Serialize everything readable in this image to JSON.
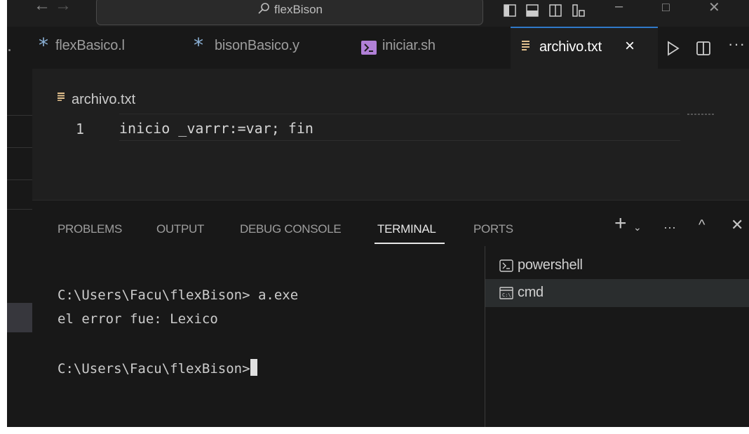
{
  "titlebar": {
    "command_center_text": "flexBison",
    "window_controls": [
      "minimize",
      "maximize",
      "close"
    ]
  },
  "tabs": [
    {
      "label": "flexBasico.l",
      "icon": "asterisk-icon",
      "active": false
    },
    {
      "label": "bisonBasico.y",
      "icon": "asterisk-icon",
      "active": false
    },
    {
      "label": "iniciar.sh",
      "icon": "terminal-script-icon",
      "active": false
    },
    {
      "label": "archivo.txt",
      "icon": "text-file-icon",
      "active": true,
      "close": "×"
    }
  ],
  "editor": {
    "breadcrumb": "archivo.txt",
    "lines": [
      {
        "number": "1",
        "text": "inicio _varrr:=var; fin"
      }
    ]
  },
  "panel": {
    "tabs": [
      "PROBLEMS",
      "OUTPUT",
      "DEBUG CONSOLE",
      "TERMINAL",
      "PORTS"
    ],
    "active_tab": "TERMINAL",
    "terminal_lines": [
      "C:\\Users\\Facu\\flexBison> a.exe",
      "el error fue: Lexico",
      "",
      "C:\\Users\\Facu\\flexBison>"
    ],
    "terminals": [
      {
        "label": "powershell",
        "icon": "powershell-icon",
        "selected": false
      },
      {
        "label": "cmd",
        "icon": "cmd-icon",
        "selected": true
      }
    ]
  },
  "colors": {
    "accent": "#2f79c9",
    "editor_bg": "#1f1f1f",
    "panel_bg": "#181818"
  }
}
